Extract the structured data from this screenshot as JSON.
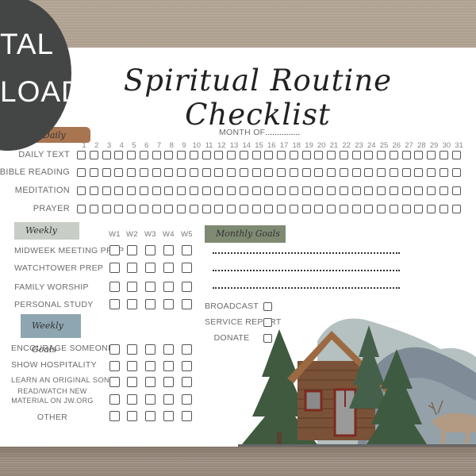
{
  "badge": {
    "line1": "TAL",
    "line2": "LOAD"
  },
  "title": "Spiritual Routine Checklist",
  "month_label": "Month of",
  "month_dots": "...............",
  "daily": {
    "section_label": "Daily",
    "days": [
      "1",
      "2",
      "3",
      "4",
      "5",
      "6",
      "7",
      "8",
      "9",
      "10",
      "11",
      "12",
      "13",
      "14",
      "15",
      "16",
      "17",
      "18",
      "19",
      "20",
      "21",
      "22",
      "23",
      "24",
      "25",
      "26",
      "27",
      "28",
      "29",
      "30",
      "31"
    ],
    "rows": [
      "Daily Text",
      "Bible Reading",
      "Meditation",
      "Prayer"
    ]
  },
  "weekly": {
    "section_label": "Weekly",
    "weeks": [
      "W1",
      "W2",
      "W3",
      "W4",
      "W5"
    ],
    "rows": [
      "Midweek meeting prep",
      "Watchtower Prep",
      "Family Worship",
      "Personal Study"
    ]
  },
  "weekly_goals": {
    "section_label": "Weekly Goals",
    "rows": [
      "Encourage Someone",
      "Show Hospitality",
      "Learn an original song",
      "Read/watch new",
      "material on JW.org",
      "Other"
    ]
  },
  "monthly_goals": {
    "section_label": "Monthly Goals",
    "blank_lines": 3,
    "items": [
      "Broadcast",
      "Service Report",
      "Donate"
    ]
  },
  "colors": {
    "daily_swatch": "#a87550",
    "weekly_swatch": "#c8cdc6",
    "weekly_goals_swatch": "#8ea6b1",
    "monthly_goals_swatch": "#7f8a72",
    "badge": "#444645"
  }
}
